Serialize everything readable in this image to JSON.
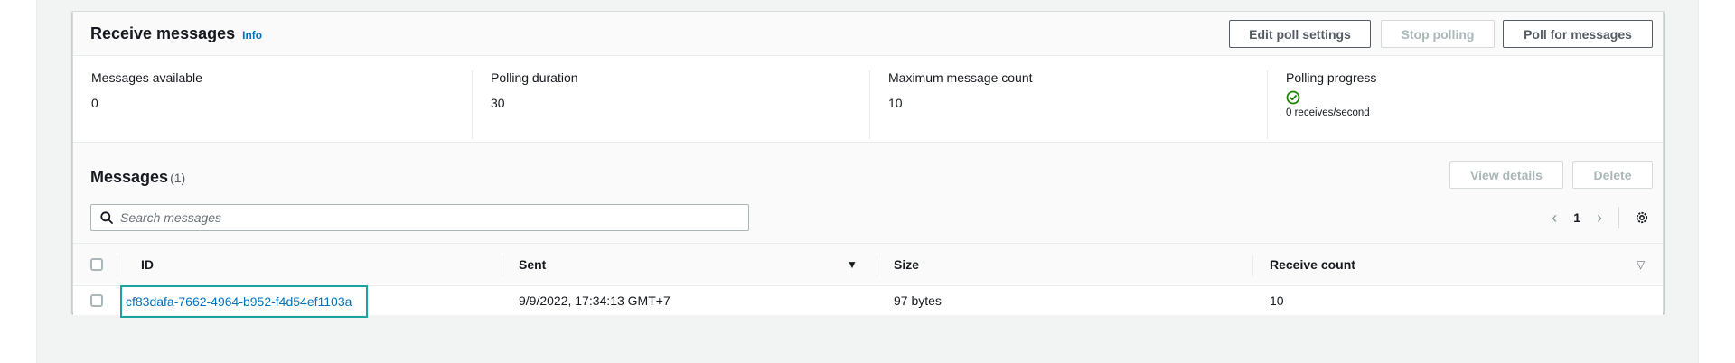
{
  "receive": {
    "title": "Receive messages",
    "info_label": "Info",
    "buttons": {
      "edit": "Edit poll settings",
      "stop": "Stop polling",
      "poll": "Poll for messages"
    }
  },
  "stats": [
    {
      "label": "Messages available",
      "value": "0"
    },
    {
      "label": "Polling duration",
      "value": "30"
    },
    {
      "label": "Maximum message count",
      "value": "10"
    },
    {
      "label": "Polling progress",
      "icon": "check-circle-icon",
      "value": "0 receives/second"
    }
  ],
  "messages": {
    "title": "Messages",
    "count": "(1)",
    "buttons": {
      "view": "View details",
      "delete": "Delete"
    },
    "search_placeholder": "Search messages",
    "page": "1",
    "columns": [
      "ID",
      "Sent",
      "Size",
      "Receive count"
    ],
    "rows": [
      {
        "id": "cf83dafa-7662-4964-b952-f4d54ef1103a",
        "sent": "9/9/2022, 17:34:13 GMT+7",
        "size": "97 bytes",
        "receive_count": "10"
      }
    ]
  },
  "colors": {
    "link": "#0073bb",
    "highlight": "#1aa39f",
    "success": "#1d8102",
    "disabled": "#aab7b8"
  }
}
